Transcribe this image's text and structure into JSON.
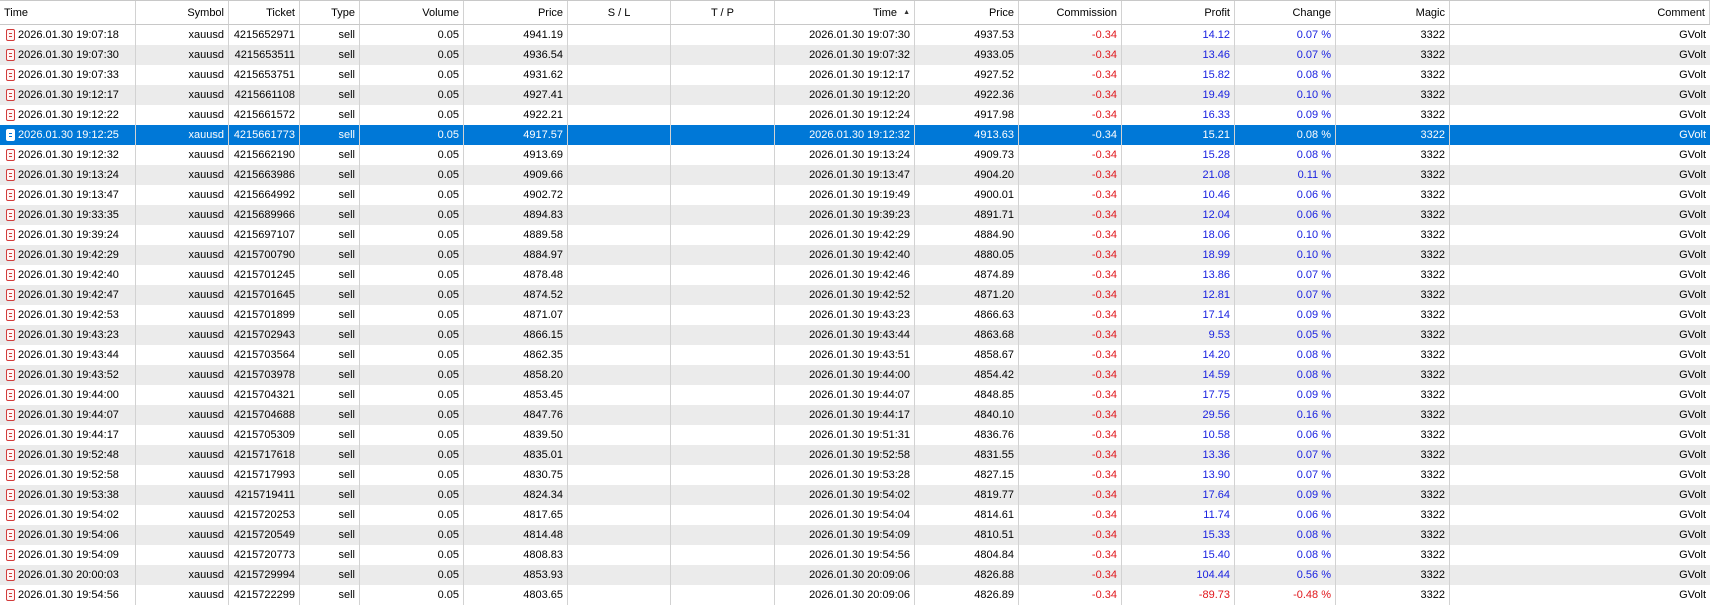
{
  "columns": [
    "Time",
    "Symbol",
    "Ticket",
    "Type",
    "Volume",
    "Price",
    "S / L",
    "T / P",
    "Time",
    "Price",
    "Commission",
    "Profit",
    "Change",
    "Magic",
    "Comment"
  ],
  "sort": {
    "column_index": 8,
    "direction": "ascending",
    "icon": "sort-ascending-icon"
  },
  "icons": {
    "order": "order-document-icon"
  },
  "colors": {
    "negative": "#e0161b",
    "positive": "#1a22e0",
    "selection": "#0078d7"
  },
  "selected_row_index": 5,
  "rows": [
    {
      "open_time": "2026.01.30 19:07:18",
      "symbol": "xauusd",
      "ticket": "4215652971",
      "type": "sell",
      "volume": "0.05",
      "open_price": "4941.19",
      "sl": "",
      "tp": "",
      "close_time": "2026.01.30 19:07:30",
      "close_price": "4937.53",
      "commission": "-0.34",
      "profit": "14.12",
      "change": "0.07 %",
      "magic": "3322",
      "comment": "GVolt"
    },
    {
      "open_time": "2026.01.30 19:07:30",
      "symbol": "xauusd",
      "ticket": "4215653511",
      "type": "sell",
      "volume": "0.05",
      "open_price": "4936.54",
      "sl": "",
      "tp": "",
      "close_time": "2026.01.30 19:07:32",
      "close_price": "4933.05",
      "commission": "-0.34",
      "profit": "13.46",
      "change": "0.07 %",
      "magic": "3322",
      "comment": "GVolt"
    },
    {
      "open_time": "2026.01.30 19:07:33",
      "symbol": "xauusd",
      "ticket": "4215653751",
      "type": "sell",
      "volume": "0.05",
      "open_price": "4931.62",
      "sl": "",
      "tp": "",
      "close_time": "2026.01.30 19:12:17",
      "close_price": "4927.52",
      "commission": "-0.34",
      "profit": "15.82",
      "change": "0.08 %",
      "magic": "3322",
      "comment": "GVolt"
    },
    {
      "open_time": "2026.01.30 19:12:17",
      "symbol": "xauusd",
      "ticket": "4215661108",
      "type": "sell",
      "volume": "0.05",
      "open_price": "4927.41",
      "sl": "",
      "tp": "",
      "close_time": "2026.01.30 19:12:20",
      "close_price": "4922.36",
      "commission": "-0.34",
      "profit": "19.49",
      "change": "0.10 %",
      "magic": "3322",
      "comment": "GVolt"
    },
    {
      "open_time": "2026.01.30 19:12:22",
      "symbol": "xauusd",
      "ticket": "4215661572",
      "type": "sell",
      "volume": "0.05",
      "open_price": "4922.21",
      "sl": "",
      "tp": "",
      "close_time": "2026.01.30 19:12:24",
      "close_price": "4917.98",
      "commission": "-0.34",
      "profit": "16.33",
      "change": "0.09 %",
      "magic": "3322",
      "comment": "GVolt"
    },
    {
      "open_time": "2026.01.30 19:12:25",
      "symbol": "xauusd",
      "ticket": "4215661773",
      "type": "sell",
      "volume": "0.05",
      "open_price": "4917.57",
      "sl": "",
      "tp": "",
      "close_time": "2026.01.30 19:12:32",
      "close_price": "4913.63",
      "commission": "-0.34",
      "profit": "15.21",
      "change": "0.08 %",
      "magic": "3322",
      "comment": "GVolt"
    },
    {
      "open_time": "2026.01.30 19:12:32",
      "symbol": "xauusd",
      "ticket": "4215662190",
      "type": "sell",
      "volume": "0.05",
      "open_price": "4913.69",
      "sl": "",
      "tp": "",
      "close_time": "2026.01.30 19:13:24",
      "close_price": "4909.73",
      "commission": "-0.34",
      "profit": "15.28",
      "change": "0.08 %",
      "magic": "3322",
      "comment": "GVolt"
    },
    {
      "open_time": "2026.01.30 19:13:24",
      "symbol": "xauusd",
      "ticket": "4215663986",
      "type": "sell",
      "volume": "0.05",
      "open_price": "4909.66",
      "sl": "",
      "tp": "",
      "close_time": "2026.01.30 19:13:47",
      "close_price": "4904.20",
      "commission": "-0.34",
      "profit": "21.08",
      "change": "0.11 %",
      "magic": "3322",
      "comment": "GVolt"
    },
    {
      "open_time": "2026.01.30 19:13:47",
      "symbol": "xauusd",
      "ticket": "4215664992",
      "type": "sell",
      "volume": "0.05",
      "open_price": "4902.72",
      "sl": "",
      "tp": "",
      "close_time": "2026.01.30 19:19:49",
      "close_price": "4900.01",
      "commission": "-0.34",
      "profit": "10.46",
      "change": "0.06 %",
      "magic": "3322",
      "comment": "GVolt"
    },
    {
      "open_time": "2026.01.30 19:33:35",
      "symbol": "xauusd",
      "ticket": "4215689966",
      "type": "sell",
      "volume": "0.05",
      "open_price": "4894.83",
      "sl": "",
      "tp": "",
      "close_time": "2026.01.30 19:39:23",
      "close_price": "4891.71",
      "commission": "-0.34",
      "profit": "12.04",
      "change": "0.06 %",
      "magic": "3322",
      "comment": "GVolt"
    },
    {
      "open_time": "2026.01.30 19:39:24",
      "symbol": "xauusd",
      "ticket": "4215697107",
      "type": "sell",
      "volume": "0.05",
      "open_price": "4889.58",
      "sl": "",
      "tp": "",
      "close_time": "2026.01.30 19:42:29",
      "close_price": "4884.90",
      "commission": "-0.34",
      "profit": "18.06",
      "change": "0.10 %",
      "magic": "3322",
      "comment": "GVolt"
    },
    {
      "open_time": "2026.01.30 19:42:29",
      "symbol": "xauusd",
      "ticket": "4215700790",
      "type": "sell",
      "volume": "0.05",
      "open_price": "4884.97",
      "sl": "",
      "tp": "",
      "close_time": "2026.01.30 19:42:40",
      "close_price": "4880.05",
      "commission": "-0.34",
      "profit": "18.99",
      "change": "0.10 %",
      "magic": "3322",
      "comment": "GVolt"
    },
    {
      "open_time": "2026.01.30 19:42:40",
      "symbol": "xauusd",
      "ticket": "4215701245",
      "type": "sell",
      "volume": "0.05",
      "open_price": "4878.48",
      "sl": "",
      "tp": "",
      "close_time": "2026.01.30 19:42:46",
      "close_price": "4874.89",
      "commission": "-0.34",
      "profit": "13.86",
      "change": "0.07 %",
      "magic": "3322",
      "comment": "GVolt"
    },
    {
      "open_time": "2026.01.30 19:42:47",
      "symbol": "xauusd",
      "ticket": "4215701645",
      "type": "sell",
      "volume": "0.05",
      "open_price": "4874.52",
      "sl": "",
      "tp": "",
      "close_time": "2026.01.30 19:42:52",
      "close_price": "4871.20",
      "commission": "-0.34",
      "profit": "12.81",
      "change": "0.07 %",
      "magic": "3322",
      "comment": "GVolt"
    },
    {
      "open_time": "2026.01.30 19:42:53",
      "symbol": "xauusd",
      "ticket": "4215701899",
      "type": "sell",
      "volume": "0.05",
      "open_price": "4871.07",
      "sl": "",
      "tp": "",
      "close_time": "2026.01.30 19:43:23",
      "close_price": "4866.63",
      "commission": "-0.34",
      "profit": "17.14",
      "change": "0.09 %",
      "magic": "3322",
      "comment": "GVolt"
    },
    {
      "open_time": "2026.01.30 19:43:23",
      "symbol": "xauusd",
      "ticket": "4215702943",
      "type": "sell",
      "volume": "0.05",
      "open_price": "4866.15",
      "sl": "",
      "tp": "",
      "close_time": "2026.01.30 19:43:44",
      "close_price": "4863.68",
      "commission": "-0.34",
      "profit": "9.53",
      "change": "0.05 %",
      "magic": "3322",
      "comment": "GVolt"
    },
    {
      "open_time": "2026.01.30 19:43:44",
      "symbol": "xauusd",
      "ticket": "4215703564",
      "type": "sell",
      "volume": "0.05",
      "open_price": "4862.35",
      "sl": "",
      "tp": "",
      "close_time": "2026.01.30 19:43:51",
      "close_price": "4858.67",
      "commission": "-0.34",
      "profit": "14.20",
      "change": "0.08 %",
      "magic": "3322",
      "comment": "GVolt"
    },
    {
      "open_time": "2026.01.30 19:43:52",
      "symbol": "xauusd",
      "ticket": "4215703978",
      "type": "sell",
      "volume": "0.05",
      "open_price": "4858.20",
      "sl": "",
      "tp": "",
      "close_time": "2026.01.30 19:44:00",
      "close_price": "4854.42",
      "commission": "-0.34",
      "profit": "14.59",
      "change": "0.08 %",
      "magic": "3322",
      "comment": "GVolt"
    },
    {
      "open_time": "2026.01.30 19:44:00",
      "symbol": "xauusd",
      "ticket": "4215704321",
      "type": "sell",
      "volume": "0.05",
      "open_price": "4853.45",
      "sl": "",
      "tp": "",
      "close_time": "2026.01.30 19:44:07",
      "close_price": "4848.85",
      "commission": "-0.34",
      "profit": "17.75",
      "change": "0.09 %",
      "magic": "3322",
      "comment": "GVolt"
    },
    {
      "open_time": "2026.01.30 19:44:07",
      "symbol": "xauusd",
      "ticket": "4215704688",
      "type": "sell",
      "volume": "0.05",
      "open_price": "4847.76",
      "sl": "",
      "tp": "",
      "close_time": "2026.01.30 19:44:17",
      "close_price": "4840.10",
      "commission": "-0.34",
      "profit": "29.56",
      "change": "0.16 %",
      "magic": "3322",
      "comment": "GVolt"
    },
    {
      "open_time": "2026.01.30 19:44:17",
      "symbol": "xauusd",
      "ticket": "4215705309",
      "type": "sell",
      "volume": "0.05",
      "open_price": "4839.50",
      "sl": "",
      "tp": "",
      "close_time": "2026.01.30 19:51:31",
      "close_price": "4836.76",
      "commission": "-0.34",
      "profit": "10.58",
      "change": "0.06 %",
      "magic": "3322",
      "comment": "GVolt"
    },
    {
      "open_time": "2026.01.30 19:52:48",
      "symbol": "xauusd",
      "ticket": "4215717618",
      "type": "sell",
      "volume": "0.05",
      "open_price": "4835.01",
      "sl": "",
      "tp": "",
      "close_time": "2026.01.30 19:52:58",
      "close_price": "4831.55",
      "commission": "-0.34",
      "profit": "13.36",
      "change": "0.07 %",
      "magic": "3322",
      "comment": "GVolt"
    },
    {
      "open_time": "2026.01.30 19:52:58",
      "symbol": "xauusd",
      "ticket": "4215717993",
      "type": "sell",
      "volume": "0.05",
      "open_price": "4830.75",
      "sl": "",
      "tp": "",
      "close_time": "2026.01.30 19:53:28",
      "close_price": "4827.15",
      "commission": "-0.34",
      "profit": "13.90",
      "change": "0.07 %",
      "magic": "3322",
      "comment": "GVolt"
    },
    {
      "open_time": "2026.01.30 19:53:38",
      "symbol": "xauusd",
      "ticket": "4215719411",
      "type": "sell",
      "volume": "0.05",
      "open_price": "4824.34",
      "sl": "",
      "tp": "",
      "close_time": "2026.01.30 19:54:02",
      "close_price": "4819.77",
      "commission": "-0.34",
      "profit": "17.64",
      "change": "0.09 %",
      "magic": "3322",
      "comment": "GVolt"
    },
    {
      "open_time": "2026.01.30 19:54:02",
      "symbol": "xauusd",
      "ticket": "4215720253",
      "type": "sell",
      "volume": "0.05",
      "open_price": "4817.65",
      "sl": "",
      "tp": "",
      "close_time": "2026.01.30 19:54:04",
      "close_price": "4814.61",
      "commission": "-0.34",
      "profit": "11.74",
      "change": "0.06 %",
      "magic": "3322",
      "comment": "GVolt"
    },
    {
      "open_time": "2026.01.30 19:54:06",
      "symbol": "xauusd",
      "ticket": "4215720549",
      "type": "sell",
      "volume": "0.05",
      "open_price": "4814.48",
      "sl": "",
      "tp": "",
      "close_time": "2026.01.30 19:54:09",
      "close_price": "4810.51",
      "commission": "-0.34",
      "profit": "15.33",
      "change": "0.08 %",
      "magic": "3322",
      "comment": "GVolt"
    },
    {
      "open_time": "2026.01.30 19:54:09",
      "symbol": "xauusd",
      "ticket": "4215720773",
      "type": "sell",
      "volume": "0.05",
      "open_price": "4808.83",
      "sl": "",
      "tp": "",
      "close_time": "2026.01.30 19:54:56",
      "close_price": "4804.84",
      "commission": "-0.34",
      "profit": "15.40",
      "change": "0.08 %",
      "magic": "3322",
      "comment": "GVolt"
    },
    {
      "open_time": "2026.01.30 20:00:03",
      "symbol": "xauusd",
      "ticket": "4215729994",
      "type": "sell",
      "volume": "0.05",
      "open_price": "4853.93",
      "sl": "",
      "tp": "",
      "close_time": "2026.01.30 20:09:06",
      "close_price": "4826.88",
      "commission": "-0.34",
      "profit": "104.44",
      "change": "0.56 %",
      "magic": "3322",
      "comment": "GVolt"
    },
    {
      "open_time": "2026.01.30 19:54:56",
      "symbol": "xauusd",
      "ticket": "4215722299",
      "type": "sell",
      "volume": "0.05",
      "open_price": "4803.65",
      "sl": "",
      "tp": "",
      "close_time": "2026.01.30 20:09:06",
      "close_price": "4826.89",
      "commission": "-0.34",
      "profit": "-89.73",
      "change": "-0.48 %",
      "magic": "3322",
      "comment": "GVolt"
    }
  ]
}
